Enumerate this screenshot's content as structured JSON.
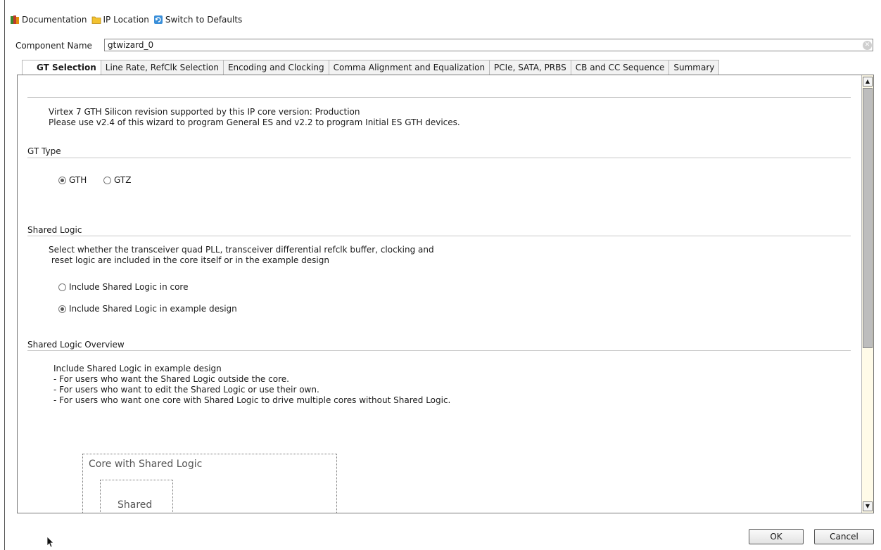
{
  "toolbar": {
    "documentation": "Documentation",
    "ip_location": "IP Location",
    "switch_defaults": "Switch to Defaults"
  },
  "component": {
    "label": "Component Name",
    "value": "gtwizard_0"
  },
  "tabs": [
    {
      "label": "GT Selection",
      "active": true
    },
    {
      "label": "Line Rate, RefClk Selection"
    },
    {
      "label": "Encoding and Clocking"
    },
    {
      "label": "Comma Alignment and Equalization"
    },
    {
      "label": "PCIe, SATA, PRBS"
    },
    {
      "label": "CB and CC Sequence"
    },
    {
      "label": "Summary"
    }
  ],
  "gt_selection": {
    "info_line1": "Virtex 7 GTH Silicon revision supported by this IP core version: Production",
    "info_line2": "Please use v2.4 of this wizard to program General ES and v2.2 to program Initial ES GTH devices.",
    "gt_type": {
      "title": "GT Type",
      "options": [
        "GTH",
        "GTZ"
      ],
      "selected": "GTH"
    },
    "shared_logic": {
      "title": "Shared Logic",
      "desc_line1": "Select whether the transceiver quad PLL, transceiver differential refclk buffer, clocking and",
      "desc_line2": " reset logic are included in the core itself or in the example design",
      "options": [
        "Include Shared Logic in core",
        "Include Shared Logic in example design"
      ],
      "selected": "Include Shared Logic in example design"
    },
    "overview": {
      "title": "Shared Logic Overview",
      "line1": "Include Shared Logic in example design",
      "line2": "- For users who want the Shared Logic outside the core.",
      "line3": "- For users who want to edit the Shared Logic or use their own.",
      "line4": "- For users who want one core with Shared Logic to drive multiple cores without Shared Logic."
    },
    "diagram": {
      "outer_label": "Core with Shared Logic",
      "inner_label": "Shared"
    }
  },
  "buttons": {
    "ok": "OK",
    "cancel": "Cancel"
  }
}
